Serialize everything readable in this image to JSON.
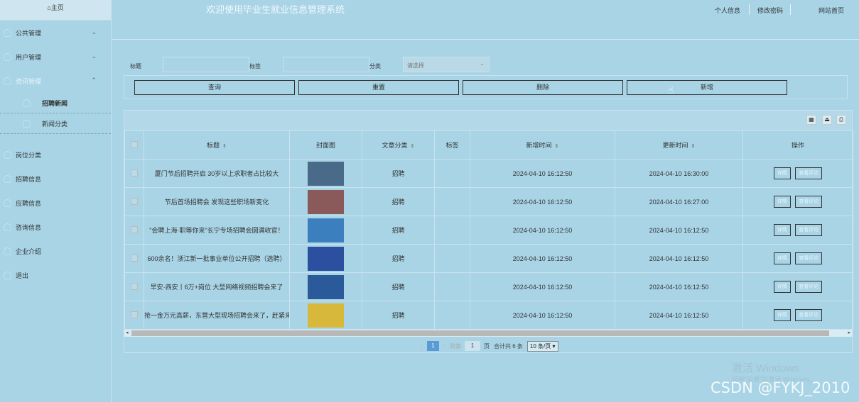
{
  "sidebar": {
    "home": "⌂主页",
    "items": [
      {
        "label": "公共管理",
        "chev": "⌄"
      },
      {
        "label": "用户管理",
        "chev": "⌄"
      },
      {
        "label": "资讯管理",
        "chev": "⌃"
      }
    ],
    "subitems": [
      {
        "label": "招聘新闻"
      },
      {
        "label": "新闻分类"
      }
    ],
    "items2": [
      {
        "label": "岗位分类"
      },
      {
        "label": "招聘信息"
      },
      {
        "label": "应聘信息"
      },
      {
        "label": "咨询信息"
      },
      {
        "label": "企业介绍"
      },
      {
        "label": "退出"
      }
    ]
  },
  "header": {
    "title": "欢迎使用毕业生就业信息管理系统",
    "profile": "个人信息",
    "password": "修改密码",
    "site_home": "网站首页"
  },
  "filter": {
    "title_label": "标题",
    "tag_label": "标签",
    "category_label": "分类",
    "category_placeholder": "请选择",
    "query": "查询",
    "reset": "重置",
    "delete": "删除",
    "add": "新增"
  },
  "table": {
    "headers": {
      "title": "标题",
      "cover": "封面图",
      "category": "文章分类",
      "tag": "标签",
      "created": "新增时间",
      "updated": "更新时间",
      "actions": "操作"
    },
    "detail_label": "详情",
    "comments_label": "查看评论",
    "rows": [
      {
        "title": "厦门节后招聘开启 30岁以上求职者占比较大",
        "category": "招聘",
        "tag": "",
        "created": "2024-04-10 16:12:50",
        "updated": "2024-04-10 16:30:00",
        "thumb": "#4a6a8a"
      },
      {
        "title": "节后首场招聘会 发现这些职场新变化",
        "category": "招聘",
        "tag": "",
        "created": "2024-04-10 16:12:50",
        "updated": "2024-04-10 16:27:00",
        "thumb": "#8a5a5a"
      },
      {
        "title": "\"会聘上海·职等你来\"长宁专场招聘会圆满收官！",
        "category": "招聘",
        "tag": "",
        "created": "2024-04-10 16:12:50",
        "updated": "2024-04-10 16:12:50",
        "thumb": "#3b7fbf"
      },
      {
        "title": "600余名！浙江新一批事业单位公开招聘（选聘）",
        "category": "招聘",
        "tag": "",
        "created": "2024-04-10 16:12:50",
        "updated": "2024-04-10 16:12:50",
        "thumb": "#2d4fa0"
      },
      {
        "title": "早安·西安丨6万+岗位 大型网络视频招聘会来了",
        "category": "招聘",
        "tag": "",
        "created": "2024-04-10 16:12:50",
        "updated": "2024-04-10 16:12:50",
        "thumb": "#2a5a9a"
      },
      {
        "title": "抢一金万元高薪，东营大型现场招聘会来了，赶紧来",
        "category": "招聘",
        "tag": "",
        "created": "2024-04-10 16:12:50",
        "updated": "2024-04-10 16:12:50",
        "thumb": "#d8b83a"
      }
    ]
  },
  "pager": {
    "prev": "‹",
    "page": "1",
    "next": "›",
    "goto": "到第",
    "goto_value": "1",
    "page_unit": "页",
    "total": "合计共 6 条",
    "size": "10 条/页 ▾"
  },
  "watermark": {
    "activate": "激活 Windows",
    "activate_sub": "转到\"设置\"以激活 Windows。",
    "csdn": "CSDN @FYKJ_2010"
  }
}
